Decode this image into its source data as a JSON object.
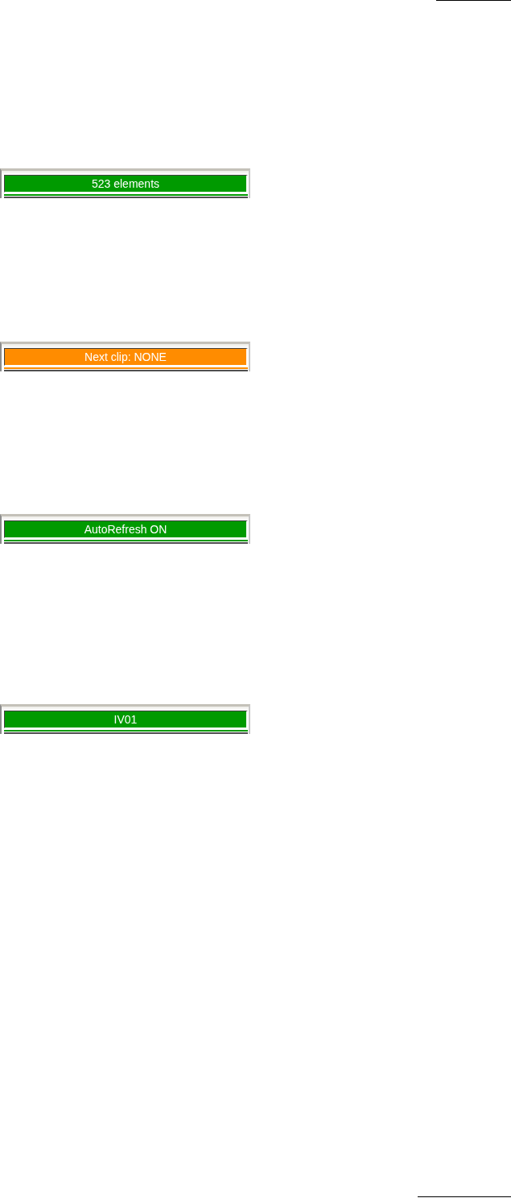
{
  "status_bars": [
    {
      "text": "523 elements",
      "color": "#009a00"
    },
    {
      "text": "Next clip: NONE",
      "color": "#ff8c00"
    },
    {
      "text": "AutoRefresh ON",
      "color": "#009a00"
    },
    {
      "text": "IV01",
      "color": "#009a00"
    }
  ]
}
